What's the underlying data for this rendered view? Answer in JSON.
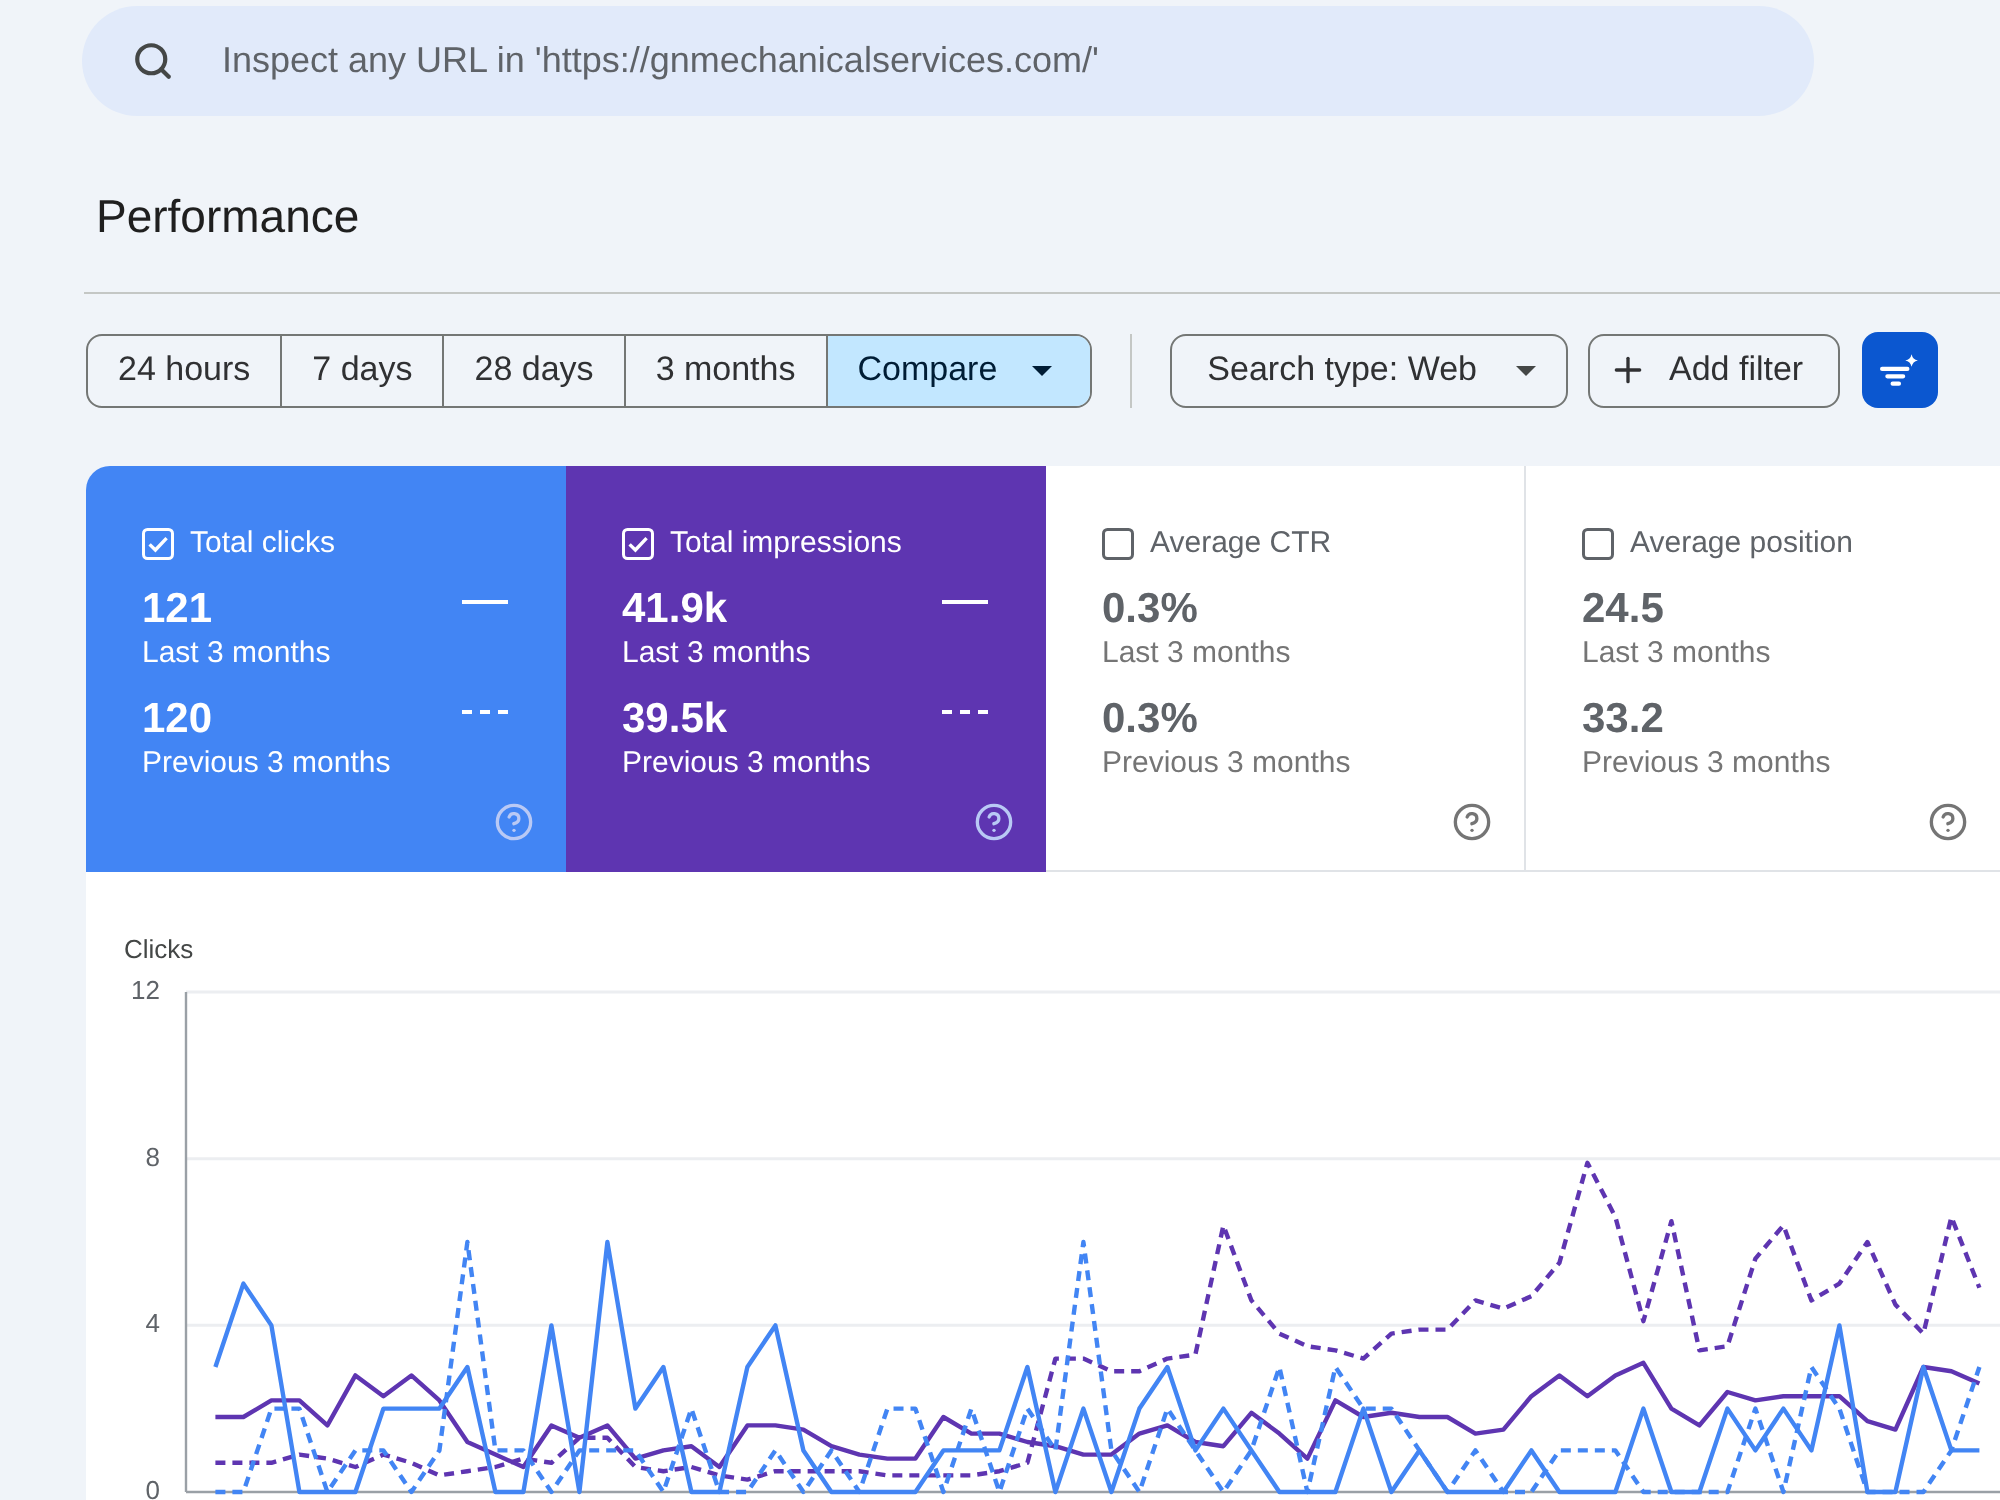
{
  "search": {
    "placeholder": "Inspect any URL in 'https://gnmechanicalservices.com/'"
  },
  "page_title": "Performance",
  "date_ranges": [
    {
      "label": "24 hours",
      "selected": false,
      "kind": "option"
    },
    {
      "label": "7 days",
      "selected": false,
      "kind": "option"
    },
    {
      "label": "28 days",
      "selected": false,
      "kind": "option"
    },
    {
      "label": "3 months",
      "selected": false,
      "kind": "option"
    },
    {
      "label": "Compare",
      "selected": true,
      "kind": "dropdown"
    }
  ],
  "filters": [
    {
      "label": "Search type: Web",
      "kind": "dropdown"
    },
    {
      "label": "Add filter",
      "kind": "add"
    }
  ],
  "metrics": [
    {
      "label": "Total clicks",
      "checked": true,
      "color": "#4285f4",
      "current": {
        "value": "121",
        "period": "Last 3 months"
      },
      "previous": {
        "value": "120",
        "period": "Previous 3 months"
      }
    },
    {
      "label": "Total impressions",
      "checked": true,
      "color": "#5e35b1",
      "current": {
        "value": "41.9k",
        "period": "Last 3 months"
      },
      "previous": {
        "value": "39.5k",
        "period": "Previous 3 months"
      }
    },
    {
      "label": "Average CTR",
      "checked": false,
      "current": {
        "value": "0.3%",
        "period": "Last 3 months"
      },
      "previous": {
        "value": "0.3%",
        "period": "Previous 3 months"
      }
    },
    {
      "label": "Average position",
      "checked": false,
      "current": {
        "value": "24.5",
        "period": "Last 3 months"
      },
      "previous": {
        "value": "33.2",
        "period": "Previous 3 months"
      }
    }
  ],
  "chart": {
    "chart_data": {
      "type": "line",
      "ylabel": "Clicks",
      "ylim": [
        0,
        12
      ],
      "yticks": [
        0,
        4,
        8,
        12
      ],
      "grid": true,
      "series": [
        {
          "color": "#5e35b1",
          "line_style": "dashed",
          "values": [
            0.7,
            0.7,
            0.7,
            0.9,
            0.8,
            0.6,
            0.9,
            0.7,
            0.4,
            0.5,
            0.6,
            0.8,
            0.7,
            1.3,
            1.3,
            0.6,
            0.5,
            0.6,
            0.4,
            0.3,
            0.5,
            0.5,
            0.5,
            0.5,
            0.4,
            0.4,
            0.4,
            0.4,
            0.5,
            0.7,
            3.2,
            3.2,
            2.9,
            2.9,
            3.2,
            3.3,
            6.4,
            4.6,
            3.8,
            3.5,
            3.4,
            3.2,
            3.8,
            3.9,
            3.9,
            4.6,
            4.4,
            4.7,
            5.5,
            7.9,
            6.6,
            4.1,
            6.5,
            3.4,
            3.5,
            5.6,
            6.4,
            4.6,
            5.0,
            6.0,
            4.5,
            3.8,
            6.6,
            4.9
          ]
        },
        {
          "color": "#5e35b1",
          "line_style": "solid",
          "values": [
            1.8,
            1.8,
            2.2,
            2.2,
            1.6,
            2.8,
            2.3,
            2.8,
            2.2,
            1.2,
            0.9,
            0.6,
            1.6,
            1.3,
            1.6,
            0.8,
            1.0,
            1.1,
            0.6,
            1.6,
            1.6,
            1.5,
            1.1,
            0.9,
            0.8,
            0.8,
            1.8,
            1.4,
            1.4,
            1.2,
            1.1,
            0.9,
            0.9,
            1.4,
            1.6,
            1.2,
            1.1,
            1.9,
            1.4,
            0.8,
            2.2,
            1.8,
            1.9,
            1.8,
            1.8,
            1.4,
            1.5,
            2.3,
            2.8,
            2.3,
            2.8,
            3.1,
            2.0,
            1.6,
            2.4,
            2.2,
            2.3,
            2.3,
            2.3,
            1.7,
            1.5,
            3.0,
            2.9,
            2.6
          ]
        },
        {
          "color": "#4285f4",
          "line_style": "dashed",
          "values": [
            0,
            0,
            2,
            2,
            0,
            1,
            1,
            0,
            1,
            6,
            1,
            1,
            0,
            1,
            1,
            1,
            0,
            2,
            0,
            0,
            1,
            0,
            1,
            0,
            2,
            2,
            0,
            2,
            0,
            2,
            1,
            6,
            1,
            0,
            2,
            1,
            0,
            1,
            3,
            0,
            3,
            2,
            2,
            1,
            0,
            1,
            0,
            0,
            1,
            1,
            1,
            0,
            0,
            0,
            0,
            2,
            0,
            3,
            2,
            0,
            0,
            0,
            1,
            3
          ]
        },
        {
          "color": "#4285f4",
          "line_style": "solid",
          "values": [
            3,
            5,
            4,
            0,
            0,
            0,
            2,
            2,
            2,
            3,
            0,
            0,
            4,
            0,
            6,
            2,
            3,
            0,
            0,
            3,
            4,
            1,
            0,
            0,
            0,
            0,
            1,
            1,
            1,
            3,
            0,
            2,
            0,
            2,
            3,
            1,
            2,
            1,
            0,
            0,
            0,
            2,
            0,
            1,
            0,
            0,
            0,
            1,
            0,
            0,
            0,
            2,
            0,
            0,
            2,
            1,
            2,
            1,
            4,
            0,
            0,
            3,
            1,
            1
          ]
        }
      ]
    }
  }
}
